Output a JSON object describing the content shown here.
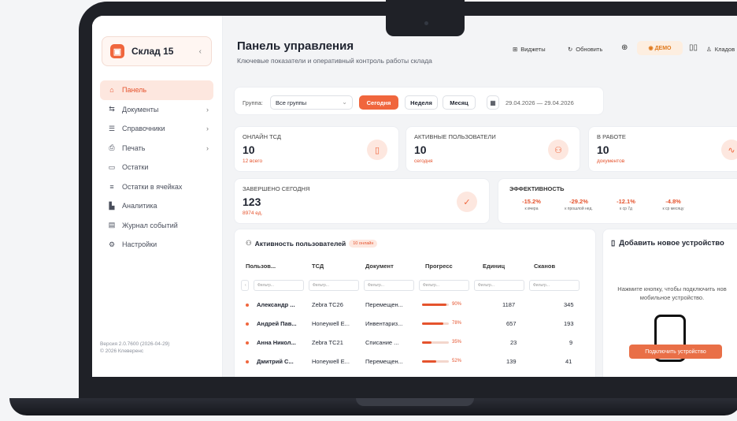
{
  "sidebar": {
    "warehouse": "Склад 15",
    "items": [
      {
        "label": "Панель",
        "icon": "home-icon"
      },
      {
        "label": "Документы",
        "icon": "documents-icon"
      },
      {
        "label": "Справочники",
        "icon": "database-icon"
      },
      {
        "label": "Печать",
        "icon": "printer-icon"
      },
      {
        "label": "Остатки",
        "icon": "archive-icon"
      },
      {
        "label": "Остатки в ячейках",
        "icon": "list-icon"
      },
      {
        "label": "Аналитика",
        "icon": "chart-icon"
      },
      {
        "label": "Журнал событий",
        "icon": "journal-icon"
      },
      {
        "label": "Настройки",
        "icon": "gear-icon"
      }
    ],
    "version": "Версия 2.0.7600 (2026-04-29)",
    "copyright": "© 2026 Клеверенс"
  },
  "header": {
    "title": "Панель управления",
    "subtitle": "Ключевые показатели и оперативный контроль работы склада",
    "widgets": "Виджеты",
    "refresh": "Обновить",
    "demo": "ДЕМО",
    "user": "Кладов"
  },
  "filters": {
    "group_label": "Группа:",
    "group_value": "Все группы",
    "today": "Сегодня",
    "week": "Неделя",
    "month": "Месяц",
    "range": "29.04.2026 — 29.04.2026"
  },
  "kpi": {
    "online": {
      "label": "ОНЛАЙН ТСД",
      "value": "10",
      "sub": "12 всего"
    },
    "active": {
      "label": "АКТИВНЫЕ ПОЛЬЗОВАТЕЛИ",
      "value": "10",
      "sub": "сегодня"
    },
    "working": {
      "label": "В РАБОТЕ",
      "value": "10",
      "sub": "документов"
    },
    "done": {
      "label": "ЗАВЕРШЕНО СЕГОДНЯ",
      "value": "123",
      "sub": "8974 ед."
    }
  },
  "efficiency": {
    "title": "ЭФФЕКТИВНОСТЬ",
    "items": [
      {
        "value": "-15.2%",
        "label": "к вчера"
      },
      {
        "value": "-29.2%",
        "label": "к прошлой нед."
      },
      {
        "value": "-12.1%",
        "label": "к ср 7д"
      },
      {
        "value": "-4.8%",
        "label": "к ср месяцу"
      }
    ]
  },
  "users_table": {
    "title": "Активность пользователей",
    "badge": "10 онлайн",
    "columns": [
      "Пользов...",
      "ТСД",
      "Документ",
      "Прогресс",
      "Единиц",
      "Сканов"
    ],
    "filter_placeholder": "Фильтр...",
    "rows": [
      {
        "user": "Александр ...",
        "device": "Zebra TC26",
        "doc": "Перемещен...",
        "progress": 90,
        "progress_label": "90%",
        "units": "1187",
        "scans": "345"
      },
      {
        "user": "Андрей Пав...",
        "device": "Honeywell E...",
        "doc": "Инвентариз...",
        "progress": 78,
        "progress_label": "78%",
        "units": "657",
        "scans": "193"
      },
      {
        "user": "Анна Никол...",
        "device": "Zebra TC21",
        "doc": "Списание ...",
        "progress": 35,
        "progress_label": "35%",
        "units": "23",
        "scans": "9"
      },
      {
        "user": "Дмитрий С...",
        "device": "Honeywell E...",
        "doc": "Перемещен...",
        "progress": 52,
        "progress_label": "52%",
        "units": "139",
        "scans": "41"
      }
    ]
  },
  "device_card": {
    "title": "Добавить новое устройство",
    "text1": "Нажмите кнопку, чтобы подключить нов",
    "text2": "мобильное устройство.",
    "button": "Подключить устройство"
  },
  "colors": {
    "accent": "#f0663d",
    "accent_light": "#fde7df"
  }
}
